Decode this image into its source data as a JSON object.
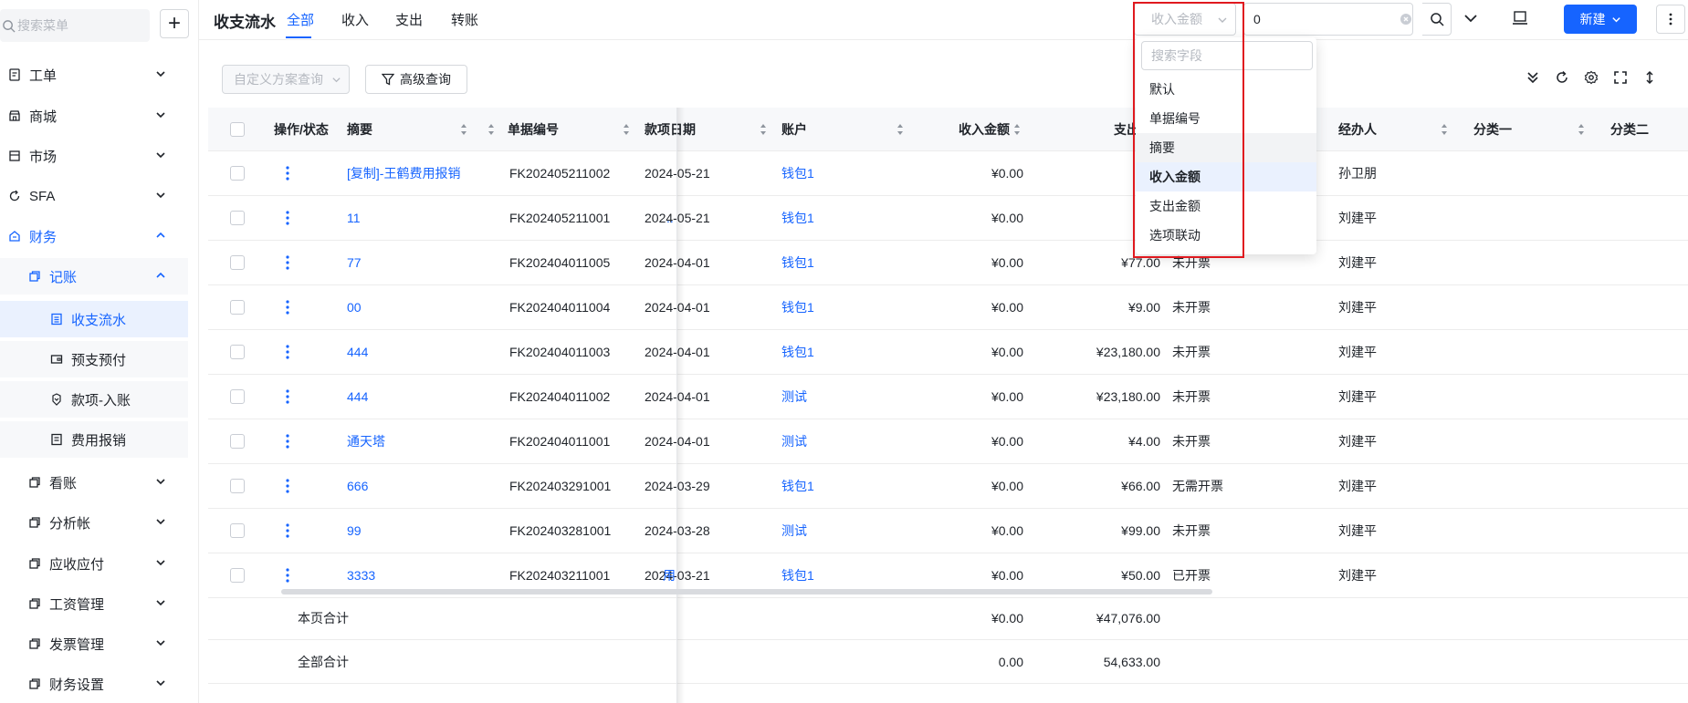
{
  "sidebar": {
    "search_placeholder": "搜索菜单",
    "add_label": "+",
    "items": [
      {
        "label": "工单"
      },
      {
        "label": "商城"
      },
      {
        "label": "市场"
      },
      {
        "label": "SFA"
      },
      {
        "label": "财务"
      },
      {
        "label": "记账"
      },
      {
        "label": "收支流水"
      },
      {
        "label": "预支预付"
      },
      {
        "label": "款项-入账"
      },
      {
        "label": "费用报销"
      },
      {
        "label": "看账"
      },
      {
        "label": "分析帐"
      },
      {
        "label": "应收应付"
      },
      {
        "label": "工资管理"
      },
      {
        "label": "发票管理"
      },
      {
        "label": "财务设置"
      }
    ]
  },
  "header": {
    "title": "收支流水",
    "tabs": [
      {
        "label": "全部"
      },
      {
        "label": "收入"
      },
      {
        "label": "支出"
      },
      {
        "label": "转账"
      }
    ],
    "field_select": "收入金额",
    "search_value": "0",
    "new_label": "新建"
  },
  "toolbar": {
    "scheme_placeholder": "自定义方案查询",
    "advanced_label": "高级查询"
  },
  "table": {
    "columns": {
      "op": "操作/状态",
      "summary": "摘要",
      "doc_no": "单据编号",
      "date": "款项日期",
      "account": "账户",
      "income": "收入金额",
      "expense": "支出",
      "handler": "经办人",
      "cat1": "分类一",
      "cat2": "分类二"
    },
    "rows": [
      {
        "summary": "[复制]-王鹤费用报销",
        "doc_no": "FK202405211002",
        "date": "2024-05-21",
        "account": "钱包1",
        "income": "¥0.00",
        "expense": "",
        "invoice": "",
        "handler": "孙卫朋"
      },
      {
        "summary": "11",
        "doc_no": "FK202405211001",
        "date": "2024-05-21",
        "account": "钱包1",
        "income": "¥0.00",
        "expense": "",
        "invoice": "",
        "handler": "刘建平"
      },
      {
        "summary": "77",
        "doc_no": "FK202404011005",
        "date": "2024-04-01",
        "account": "钱包1",
        "income": "¥0.00",
        "expense": "¥77.00",
        "invoice": "未开票",
        "handler": "刘建平"
      },
      {
        "summary": "00",
        "doc_no": "FK202404011004",
        "date": "2024-04-01",
        "account": "钱包1",
        "income": "¥0.00",
        "expense": "¥9.00",
        "invoice": "未开票",
        "handler": "刘建平"
      },
      {
        "summary": "444",
        "doc_no": "FK202404011003",
        "date": "2024-04-01",
        "account": "钱包1",
        "income": "¥0.00",
        "expense": "¥23,180.00",
        "invoice": "未开票",
        "handler": "刘建平"
      },
      {
        "summary": "444",
        "doc_no": "FK202404011002",
        "date": "2024-04-01",
        "account": "测试",
        "income": "¥0.00",
        "expense": "¥23,180.00",
        "invoice": "未开票",
        "handler": "刘建平"
      },
      {
        "summary": "通天塔",
        "doc_no": "FK202404011001",
        "date": "2024-04-01",
        "account": "测试",
        "income": "¥0.00",
        "expense": "¥4.00",
        "invoice": "未开票",
        "handler": "刘建平"
      },
      {
        "summary": "666",
        "doc_no": "FK202403291001",
        "date": "2024-03-29",
        "account": "钱包1",
        "income": "¥0.00",
        "expense": "¥66.00",
        "invoice": "无需开票",
        "handler": "刘建平"
      },
      {
        "summary": "99",
        "doc_no": "FK202403281001",
        "date": "2024-03-28",
        "account": "测试",
        "income": "¥0.00",
        "expense": "¥99.00",
        "invoice": "未开票",
        "handler": "刘建平"
      },
      {
        "summary": "3333",
        "doc_no": "FK202403211001",
        "date": "2024-03-21",
        "account": "钱包1",
        "income": "¥0.00",
        "expense": "¥50.00",
        "invoice": "已开票",
        "handler": "刘建平"
      }
    ],
    "overflow_marks": {
      "row2": "..",
      "row10": "用"
    },
    "page_total": {
      "label": "本页合计",
      "income": "¥0.00",
      "expense": "¥47,076.00"
    },
    "all_total": {
      "label": "全部合计",
      "income": "0.00",
      "expense": "54,633.00"
    }
  },
  "dropdown": {
    "search_placeholder": "搜索字段",
    "options": [
      "默认",
      "单据编号",
      "摘要",
      "收入金额",
      "支出金额",
      "选项联动"
    ],
    "selected": "收入金额"
  },
  "colors": {
    "accent": "#1664ff",
    "highlight_box": "#e0191f",
    "selected_bg": "#eaf1fe"
  }
}
